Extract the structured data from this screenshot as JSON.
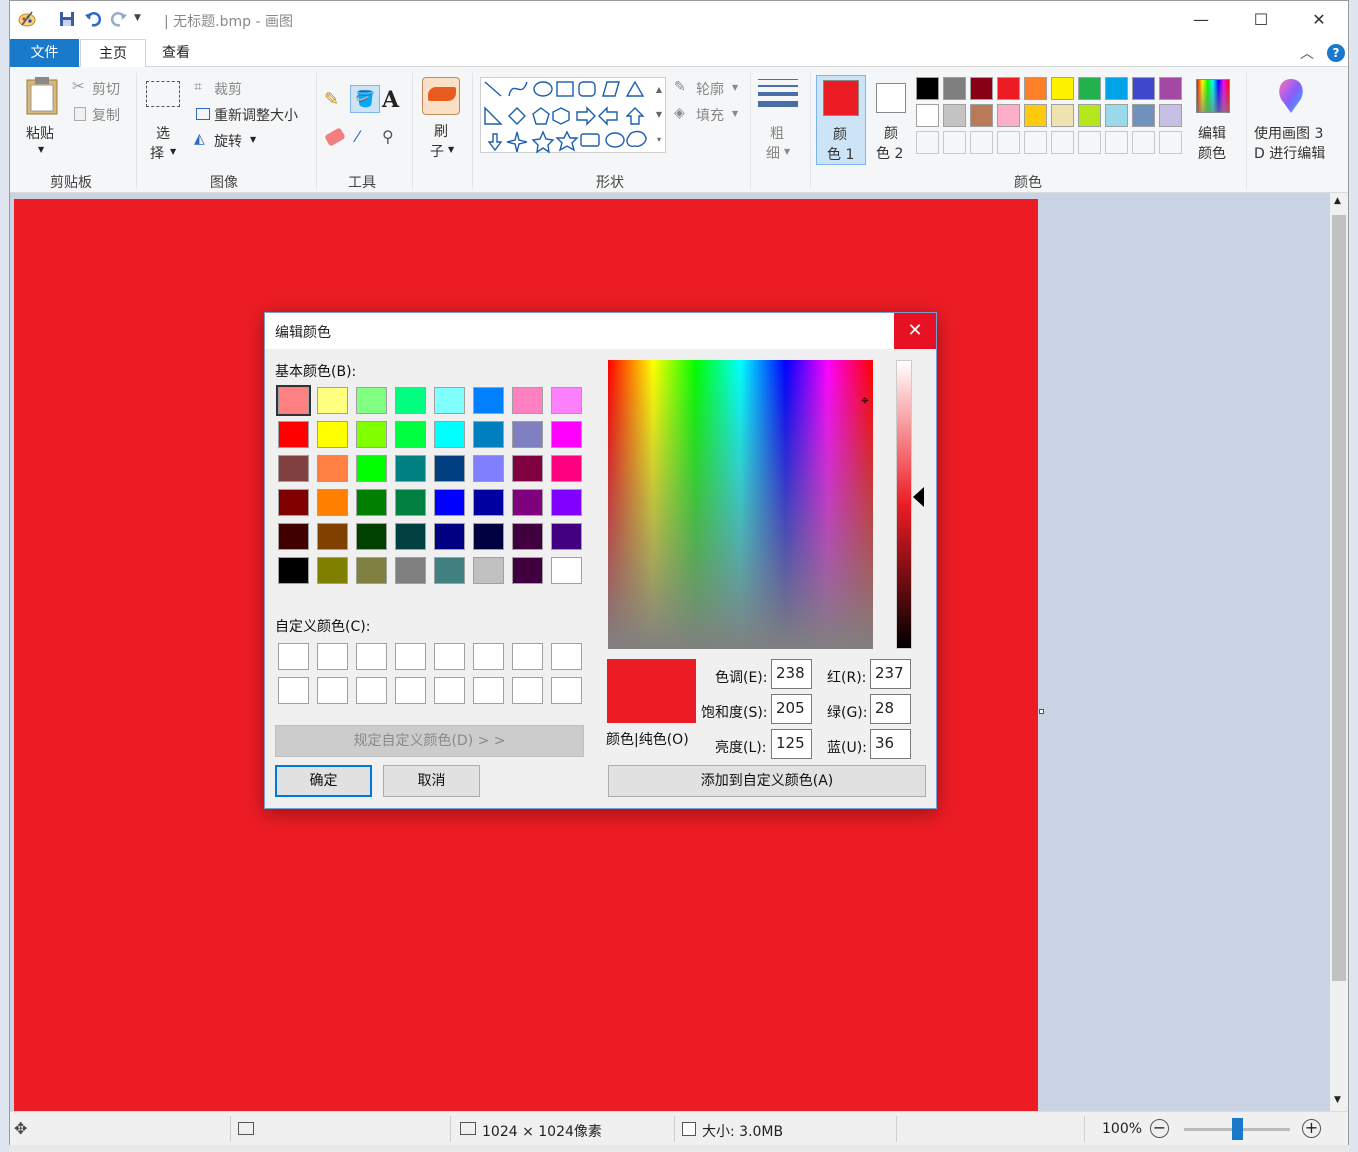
{
  "titlebar": {
    "title": "| 无标题.bmp - 画图",
    "minimize": "—",
    "maximize": "☐",
    "close": "✕"
  },
  "tabs": {
    "file": "文件",
    "home": "主页",
    "view": "查看"
  },
  "ribbon": {
    "clipboard": {
      "paste": "粘贴",
      "cut": "剪切",
      "copy": "复制",
      "label": "剪贴板"
    },
    "image": {
      "select_1": "选",
      "select_2": "择",
      "crop": "裁剪",
      "resize": "重新调整大小",
      "rotate": "旋转",
      "label": "图像"
    },
    "tools": {
      "text_tool": "A",
      "label": "工具"
    },
    "brushes": {
      "line1": "刷",
      "line2": "子"
    },
    "shapes": {
      "outline": "轮廓",
      "fill": "填充",
      "label": "形状"
    },
    "size": {
      "line1": "粗",
      "line2": "细"
    },
    "colors": {
      "color1_l1": "颜",
      "color1_l2": "色 1",
      "color2_l1": "颜",
      "color2_l2": "色 2",
      "edit_l1": "编辑",
      "edit_l2": "颜色",
      "label": "颜色",
      "color1_value": "#ec1c24",
      "color2_value": "#ffffff",
      "palette_row1": [
        "#000000",
        "#7f7f7f",
        "#880015",
        "#ed1c24",
        "#ff7f27",
        "#fff200",
        "#22b14c",
        "#00a2e8",
        "#3f48cc",
        "#a349a4"
      ],
      "palette_row2": [
        "#ffffff",
        "#c3c3c3",
        "#b97a57",
        "#ffaec9",
        "#ffc90e",
        "#efe4b0",
        "#b5e61d",
        "#99d9ea",
        "#7092be",
        "#c8bfe7"
      ]
    },
    "paint3d": {
      "line1": "使用画图 3",
      "line2": "D 进行编辑"
    }
  },
  "dialog": {
    "title": "编辑颜色",
    "close": "✕",
    "basic_label": "基本颜色(B):",
    "custom_label": "自定义颜色(C):",
    "define_button": "规定自定义颜色(D) > >",
    "ok": "确定",
    "cancel": "取消",
    "add_button": "添加到自定义颜色(A)",
    "solid_label": "颜色|纯色(O)",
    "hue_label": "色调(E):",
    "hue": "238",
    "sat_label": "饱和度(S):",
    "sat": "205",
    "lum_label": "亮度(L):",
    "lum": "125",
    "red_label": "红(R):",
    "red": "237",
    "green_label": "绿(G):",
    "green": "28",
    "blue_label": "蓝(U):",
    "blue": "36",
    "basic_colors": [
      "#ff8080",
      "#ffff80",
      "#80ff80",
      "#00ff80",
      "#80ffff",
      "#0080ff",
      "#ff80c0",
      "#ff80ff",
      "#ff0000",
      "#ffff00",
      "#80ff00",
      "#00ff40",
      "#00ffff",
      "#0080c0",
      "#8080c0",
      "#ff00ff",
      "#804040",
      "#ff8040",
      "#00ff00",
      "#008080",
      "#004080",
      "#8080ff",
      "#800040",
      "#ff0080",
      "#800000",
      "#ff8000",
      "#008000",
      "#008040",
      "#0000ff",
      "#0000a0",
      "#800080",
      "#8000ff",
      "#400000",
      "#804000",
      "#004000",
      "#004040",
      "#000080",
      "#000040",
      "#400040",
      "#400080",
      "#000000",
      "#808000",
      "#808040",
      "#808080",
      "#408080",
      "#c0c0c0",
      "#400040",
      "#ffffff"
    ]
  },
  "status": {
    "dimensions": "1024 × 1024像素",
    "size": "大小: 3.0MB",
    "zoom": "100%",
    "zoom_fraction": 0.5
  }
}
